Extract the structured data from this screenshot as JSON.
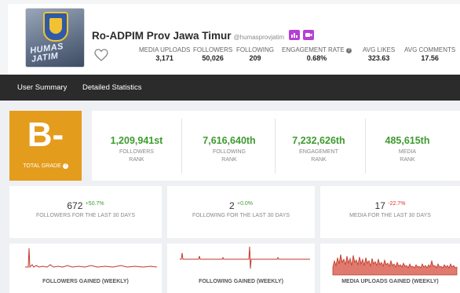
{
  "profile": {
    "name": "Ro-ADPIM Prov Jawa Timur",
    "handle": "@humasprovjatim",
    "avatar_text": "HUMAS JATIM"
  },
  "stats": [
    {
      "label": "MEDIA UPLOADS",
      "value": "3,171"
    },
    {
      "label": "FOLLOWERS",
      "value": "50,026"
    },
    {
      "label": "FOLLOWING",
      "value": "209"
    },
    {
      "label": "ENGAGEMENT RATE",
      "value": "0.68%"
    },
    {
      "label": "AVG LIKES",
      "value": "323.63"
    },
    {
      "label": "AVG COMMENTS",
      "value": "17.56"
    }
  ],
  "nav": {
    "user_summary": "User Summary",
    "detailed_statistics": "Detailed Statistics"
  },
  "grade": {
    "letter": "B-",
    "label": "TOTAL GRADE"
  },
  "ranks": [
    {
      "value": "1,209,941st",
      "label_line1": "FOLLOWERS",
      "label_line2": "RANK"
    },
    {
      "value": "7,616,640th",
      "label_line1": "FOLLOWING",
      "label_line2": "RANK"
    },
    {
      "value": "7,232,626th",
      "label_line1": "ENGAGEMENT",
      "label_line2": "RANK"
    },
    {
      "value": "485,615th",
      "label_line1": "MEDIA",
      "label_line2": "RANK"
    }
  ],
  "last30": [
    {
      "value": "672",
      "change": "+50.7%",
      "label": "FOLLOWERS FOR THE LAST 30 DAYS"
    },
    {
      "value": "2",
      "change": "+0.0%",
      "label": "FOLLOWING FOR THE LAST 30 DAYS"
    },
    {
      "value": "17",
      "change": "-22.7%",
      "label": "MEDIA FOR THE LAST 30 DAYS"
    }
  ],
  "weekly_charts": [
    {
      "label": "FOLLOWERS GAINED (WEEKLY)"
    },
    {
      "label": "FOLLOWING GAINED (WEEKLY)"
    },
    {
      "label": "MEDIA UPLOADS GAINED (WEEKLY)"
    }
  ],
  "colors": {
    "grade_bg": "#e49c1d",
    "rank_value": "#3d9b2e",
    "navbar": "#2b2b2b",
    "chart_line": "#c0392b",
    "tag_button": "#b53fd6"
  },
  "icons": [
    "heart-icon",
    "help-icon",
    "chart-icon",
    "video-icon"
  ]
}
